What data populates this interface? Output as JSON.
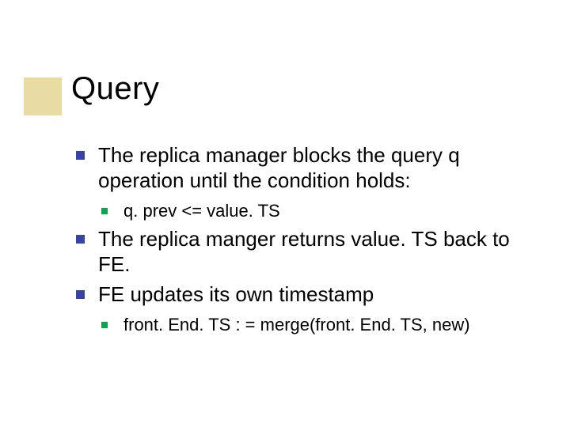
{
  "title": "Query",
  "items": {
    "l1a": "The replica manager blocks the query q operation until the condition holds:",
    "l2a": "q. prev <= value. TS",
    "l1b": "The replica manger returns value. TS back to FE.",
    "l1c": "FE updates its own timestamp",
    "l2b": "front. End. TS : = merge(front. End. TS, new)"
  }
}
